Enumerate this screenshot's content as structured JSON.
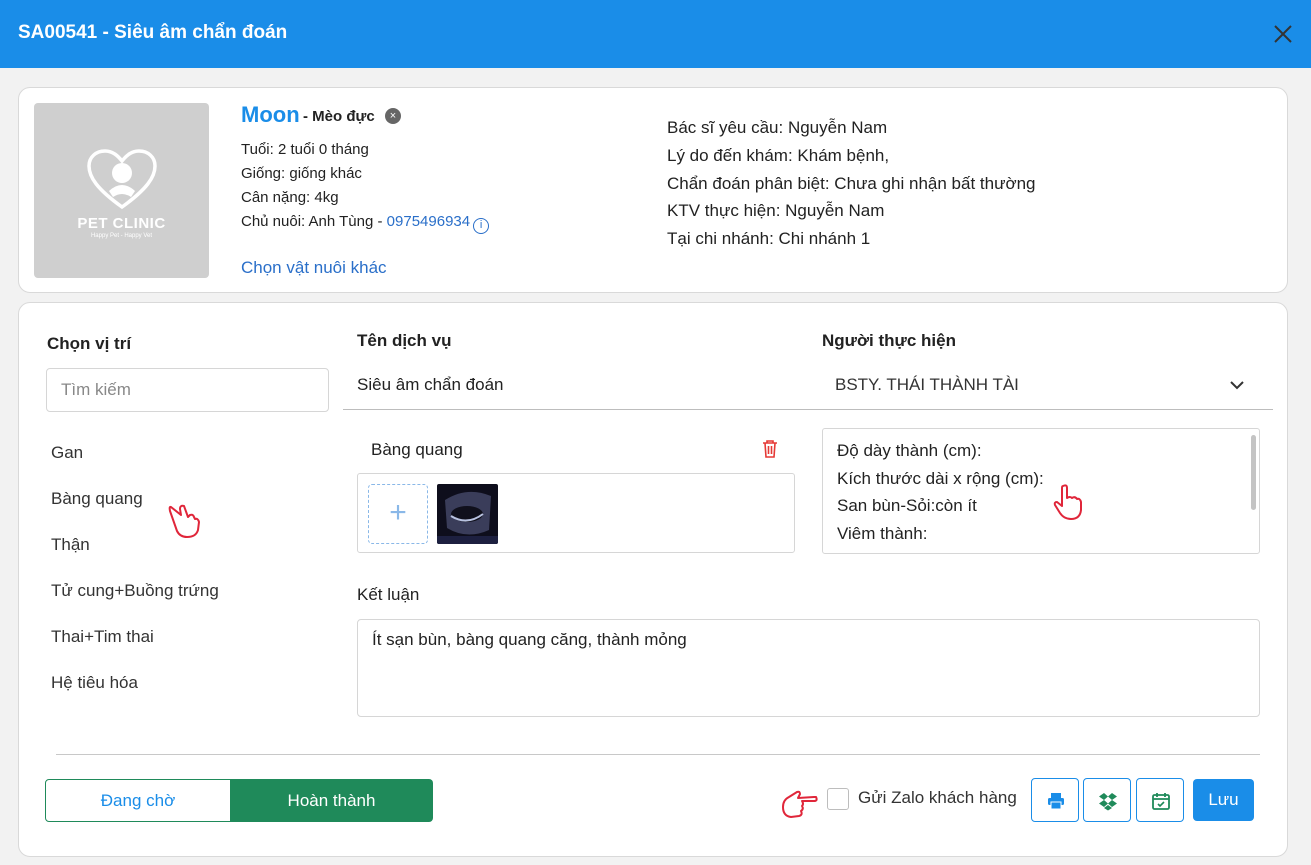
{
  "window": {
    "title": "SA00541 - Siêu âm chẩn đoán",
    "close_icon": "close-icon"
  },
  "pet": {
    "logo_text": "PET CLINIC",
    "logo_sub": "Happy Pet - Happy Vet",
    "name": "Moon",
    "species": "- Mèo đực",
    "age": "Tuổi: 2 tuổi 0 tháng",
    "breed": "Giống: giống khác",
    "weight": "Cân nặng: 4kg",
    "owner_prefix": "Chủ nuôi: Anh Tùng - ",
    "owner_phone": "0975496934",
    "choose_other": "Chọn vật nuôi khác"
  },
  "request": {
    "doctor": "Bác sĩ yêu cầu: Nguyễn Nam",
    "reason": "Lý do đến khám: Khám bệnh,",
    "diagnosis": "Chẩn đoán phân biệt: Chưa ghi nhận bất thường",
    "technician": "KTV thực hiện: Nguyễn Nam",
    "branch": "Tại chi nhánh: Chi nhánh 1"
  },
  "locations": {
    "title": "Chọn vị trí",
    "search_placeholder": "Tìm kiếm",
    "items": [
      "Gan",
      "Bàng quang",
      "Thận",
      "Tử cung+Buồng trứng",
      "Thai+Tim thai",
      "Hệ tiêu hóa"
    ]
  },
  "service": {
    "name_header": "Tên dịch vụ",
    "name_value": "Siêu âm chẩn đoán",
    "performer_header": "Người thực hiện",
    "performer_value": "BSTY. THÁI THÀNH TÀI"
  },
  "organ": {
    "name": "Bàng quang",
    "notes": [
      "Độ dày thành (cm):",
      "Kích thước dài x rộng (cm):",
      "San bùn-Sỏi:còn ít",
      "Viêm thành:"
    ]
  },
  "conclusion": {
    "label": "Kết luận",
    "value": "Ít sạn bùn, bàng quang căng, thành mỏng"
  },
  "footer": {
    "waiting": "Đang chờ",
    "done": "Hoàn thành",
    "zalo": "Gửi Zalo khách hàng",
    "save": "Lưu",
    "print_icon": "printer-icon",
    "dropbox_icon": "dropbox-icon",
    "calendar_icon": "calendar-icon"
  },
  "colors": {
    "header": "#1a8de8",
    "done_button": "#1f8a5a",
    "link": "#2a6fc9",
    "delete": "#e53935",
    "hand": "#e0263a"
  }
}
